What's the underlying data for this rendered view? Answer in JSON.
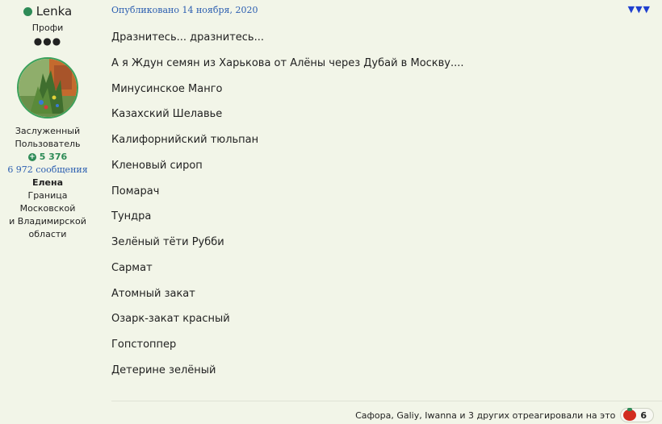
{
  "author": {
    "username": "Lenka",
    "rank": "Профи",
    "rank_pips": "●●●",
    "title_line1": "Заслуженный",
    "title_line2": "Пользователь",
    "reputation": "5 376",
    "posts": "6 972 сообщения",
    "real_name": "Елена",
    "location_line1": "Граница Московской",
    "location_line2": "и Владимирской",
    "location_line3": "области"
  },
  "post": {
    "published": "Опубликовано 14 ноября, 2020",
    "multiquote_icon": "▼▼▼",
    "lines": [
      "Дразнитесь... дразнитесь...",
      "А я Ждун семян из Харькова от Алёны через Дубай в Москву....",
      "Минусинское Манго",
      "Казахский Шелавье",
      "Калифорнийский тюльпан",
      "Кленовый сироп",
      "Помарач",
      "Тундра",
      "Зелёный тёти Рубби",
      "Сармат",
      "Атомный закат",
      "Озарк-закат красный",
      "Гопстоппер",
      "Детерине зелёный"
    ]
  },
  "reactions": {
    "text": "Сафора, Galiy, Iwanna и 3 других отреагировали на это",
    "count": "6",
    "icon": "tomato-icon"
  },
  "colors": {
    "background": "#f2f5e8",
    "online": "#2e8b57",
    "link": "#2a5db0",
    "arrow": "#1f3fcf"
  }
}
